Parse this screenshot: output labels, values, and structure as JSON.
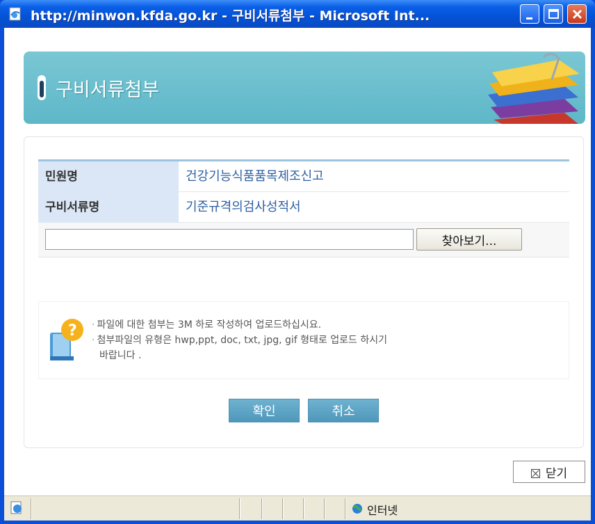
{
  "window": {
    "title": "http://minwon.kfda.go.kr - 구비서류첨부 - Microsoft Int..."
  },
  "header": {
    "title": "구비서류첨부"
  },
  "info": {
    "rows": [
      {
        "label": "민원명",
        "value": "건강기능식품품목제조신고"
      },
      {
        "label": "구비서류명",
        "value": "기준규격의검사성적서"
      }
    ],
    "file_value": "",
    "browse_label": "찾아보기..."
  },
  "help": {
    "line1": "파일에 대한 첨부는 3M  하로 작성하여 업로드하십시요.",
    "line2": "첨부파일의 유형은 hwp,ppt, doc, txt, jpg, gif 형태로 업로드 하시기",
    "line3": "바랍니다 ."
  },
  "buttons": {
    "ok_label": "확인",
    "cancel_label": "취소",
    "close_label": "닫기"
  },
  "statusbar": {
    "zone": "인터넷"
  }
}
